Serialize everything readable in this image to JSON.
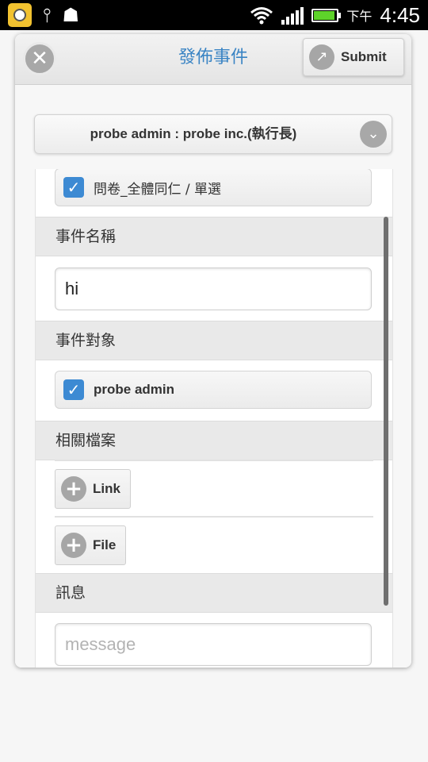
{
  "status_bar": {
    "ampm": "下午",
    "time": "4:45",
    "icons": [
      "app-camera-icon",
      "usb-icon",
      "android-debug-icon",
      "wifi-icon",
      "signal-icon",
      "battery-charging-icon"
    ]
  },
  "header": {
    "title": "發佈事件",
    "close_icon": "close-icon",
    "submit_label": "Submit",
    "submit_icon": "share-icon"
  },
  "account_select": {
    "value": "probe admin : probe inc.(執行長)",
    "icon": "chevron-down-icon"
  },
  "form": {
    "survey_option": {
      "label": "問卷_全體同仁 / 單選",
      "checked": true
    },
    "event_name": {
      "header": "事件名稱",
      "value": "hi"
    },
    "event_target": {
      "header": "事件對象",
      "option": {
        "label": "probe admin",
        "checked": true
      }
    },
    "related_files": {
      "header": "相關檔案",
      "link_label": "Link",
      "file_label": "File"
    },
    "message": {
      "header": "訊息",
      "placeholder": "message"
    }
  },
  "colors": {
    "accent": "#3a84c4",
    "checkbox": "#3d8ad3",
    "icon_gray": "#a6a6a6",
    "section_bg": "#e9e9e9"
  }
}
